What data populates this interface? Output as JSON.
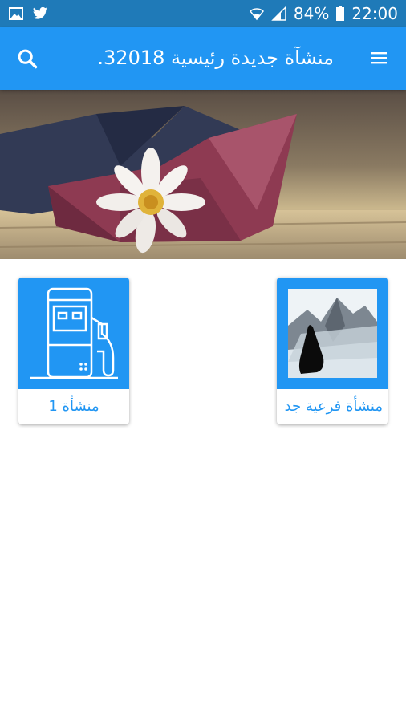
{
  "status_bar": {
    "battery_percent": "84%",
    "time": "22:00",
    "left_icons": [
      "gallery-icon",
      "twitter-icon"
    ],
    "right_icons": [
      "wifi-icon",
      "signal-icon",
      "battery-icon"
    ]
  },
  "app_bar": {
    "title": "منشآة جديدة رئيسية 32018.",
    "menu_icon": "menu-icon",
    "search_icon": "search-icon",
    "color": "#2196f3"
  },
  "banner": {
    "image": "paper-boat-with-daisy"
  },
  "cards": [
    {
      "label": "منشأة فرعية جد",
      "image": "mountains-figure-photo"
    },
    {
      "label": "منشأة 1",
      "image": "fuel-pump-icon"
    }
  ],
  "colors": {
    "accent": "#2196f3",
    "status_bar": "#1f7ab8",
    "background": "#ffffff"
  }
}
